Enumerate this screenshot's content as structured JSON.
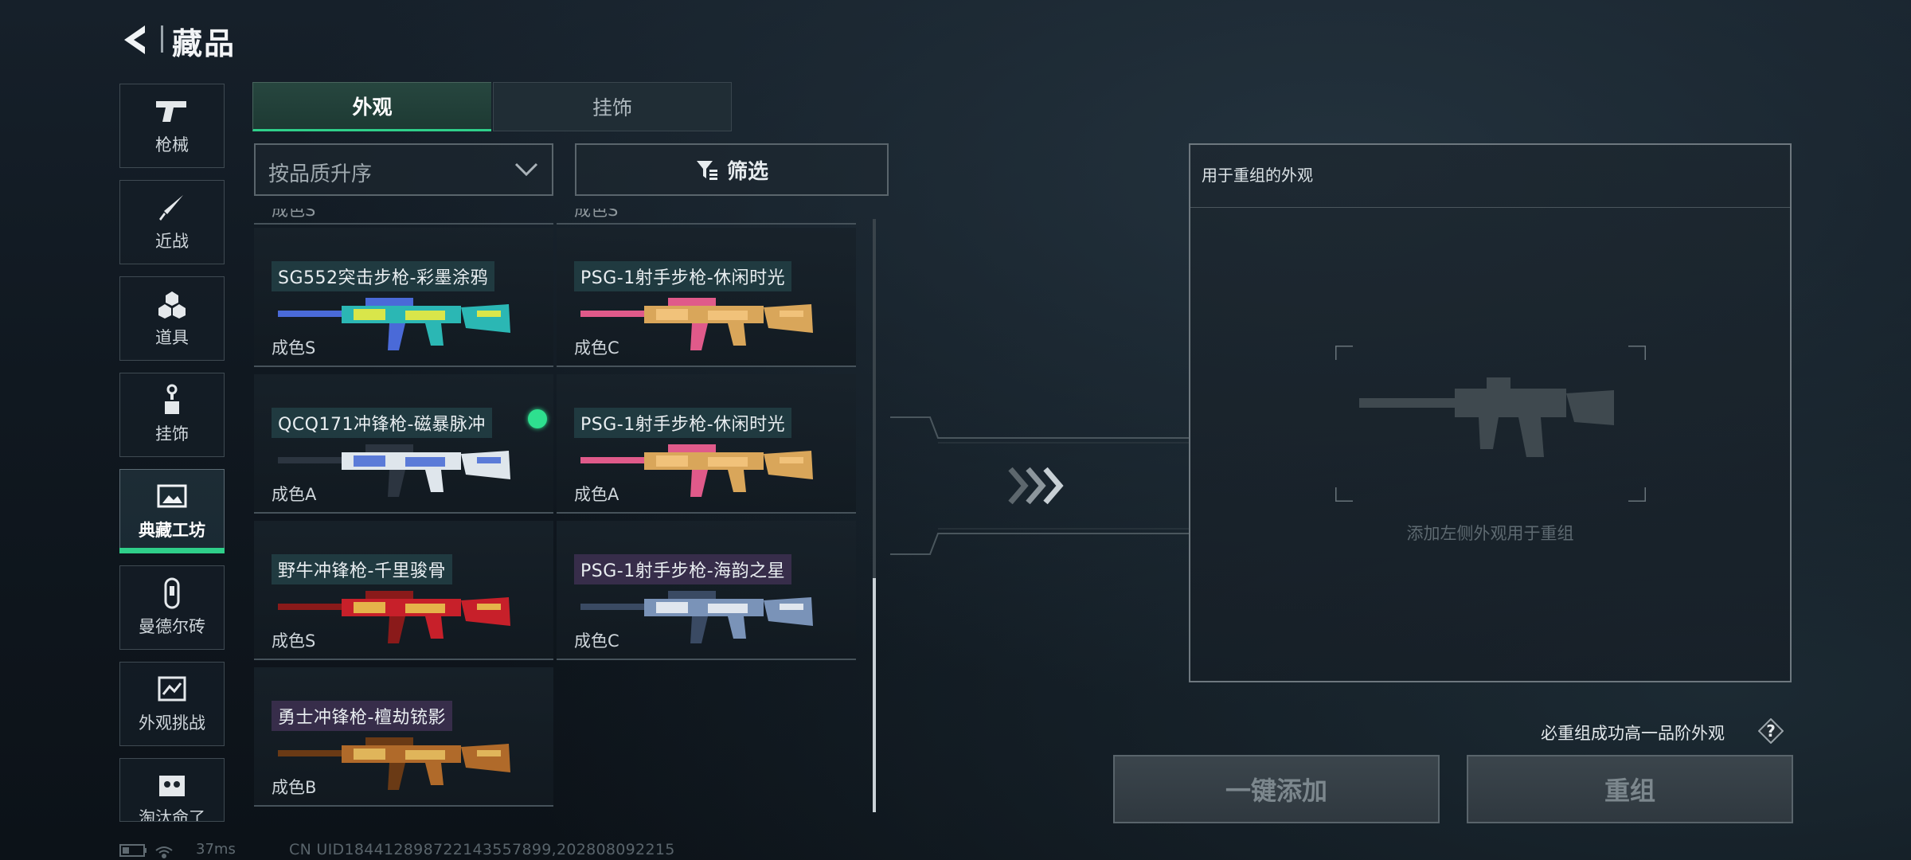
{
  "header": {
    "title": "藏品",
    "back_icon": "back-arrow-icon"
  },
  "nav": {
    "items": [
      {
        "label": "枪械",
        "icon": "pistol-icon"
      },
      {
        "label": "近战",
        "icon": "knife-icon"
      },
      {
        "label": "道具",
        "icon": "grenades-icon"
      },
      {
        "label": "挂饰",
        "icon": "charm-icon"
      },
      {
        "label": "典藏工坊",
        "icon": "gallery-icon",
        "active": true
      },
      {
        "label": "曼德尔砖",
        "icon": "brick-icon"
      },
      {
        "label": "外观挑战",
        "icon": "challenge-icon"
      },
      {
        "label": "淘汰命了",
        "icon": "skull-icon"
      }
    ]
  },
  "tabs": [
    {
      "label": "外观",
      "active": true
    },
    {
      "label": "挂饰",
      "active": false
    }
  ],
  "sort": {
    "label": "按品质升序"
  },
  "filter": {
    "label": "筛选"
  },
  "list": {
    "partial_top": [
      "成色S",
      "成色S"
    ],
    "items": [
      {
        "name": "SG552突击步枪-彩墨涂鸦",
        "grade": "成色S",
        "selected": false,
        "palette": [
          "#2bb7b4",
          "#d9e64a",
          "#4a6ad8"
        ]
      },
      {
        "name": "PSG-1射手步枪-休闲时光",
        "grade": "成色C",
        "selected": false,
        "palette": [
          "#d9a65a",
          "#f1c27a",
          "#e05a8a"
        ]
      },
      {
        "name": "QCQ171冲锋枪-磁暴脉冲",
        "grade": "成色A",
        "selected": true,
        "palette": [
          "#dfe6ec",
          "#5b7bd8",
          "#2c3540"
        ]
      },
      {
        "name": "PSG-1射手步枪-休闲时光",
        "grade": "成色A",
        "selected": false,
        "palette": [
          "#d9a65a",
          "#f1c27a",
          "#e05a8a"
        ]
      },
      {
        "name": "野牛冲锋枪-千里骏骨",
        "grade": "成色S",
        "selected": false,
        "palette": [
          "#c7202a",
          "#e5b34a",
          "#8a1a1a"
        ]
      },
      {
        "name": "PSG-1射手步枪-海韵之星",
        "grade": "成色C",
        "selected": false,
        "palette": [
          "#7a93b8",
          "#e0e6ee",
          "#3a4a63"
        ],
        "purple": true
      },
      {
        "name": "勇士冲锋枪-檀劫铳影",
        "grade": "成色B",
        "selected": false,
        "palette": [
          "#b06a2a",
          "#e0b55a",
          "#6a3a15"
        ],
        "purple": true
      }
    ]
  },
  "panel": {
    "title": "用于重组的外观",
    "placeholder": "添加左侧外观用于重组"
  },
  "guarantee_text": "必重组成功高一品阶外观",
  "help_icon": "question-icon",
  "buttons": {
    "add_all": "一键添加",
    "regroup": "重组"
  },
  "status": {
    "ping": "37ms",
    "uid": "CN UID18441289872214355789​9,202808092215"
  },
  "colors": {
    "accent": "#2fcf8a",
    "selected_dot": "#2ee08f"
  }
}
